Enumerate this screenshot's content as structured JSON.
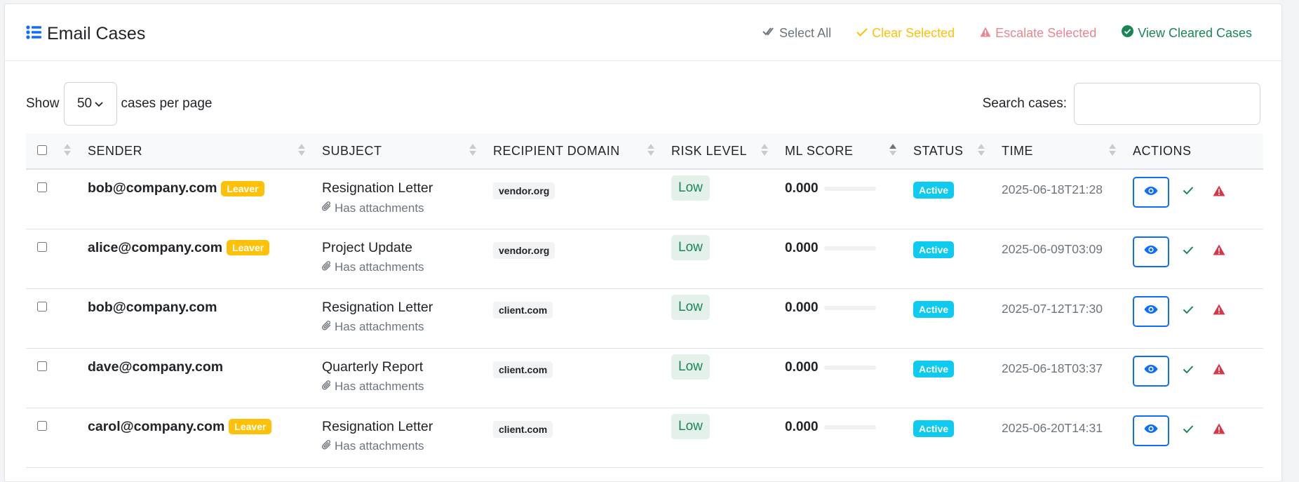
{
  "header": {
    "title": "Email Cases",
    "actions": {
      "select_all": "Select All",
      "clear_selected": "Clear Selected",
      "escalate_selected": "Escalate Selected",
      "view_cleared": "View Cleared Cases"
    }
  },
  "toolbar": {
    "show_label": "Show",
    "per_page_value": "50",
    "per_page_suffix": "cases per page",
    "search_label": "Search cases:",
    "search_value": ""
  },
  "table": {
    "columns": [
      "SENDER",
      "SUBJECT",
      "RECIPIENT DOMAIN",
      "RISK LEVEL",
      "ML SCORE",
      "STATUS",
      "TIME",
      "ACTIONS"
    ],
    "rows": [
      {
        "sender": "bob@company.com",
        "leaver": "Leaver",
        "subject": "Resignation Letter",
        "attachments": "Has attachments",
        "domain": "vendor.org",
        "risk": "Low",
        "ml_score": "0.000",
        "ml_fraction": 0,
        "status": "Active",
        "time": "2025-06-18T21:28"
      },
      {
        "sender": "alice@company.com",
        "leaver": "Leaver",
        "subject": "Project Update",
        "attachments": "Has attachments",
        "domain": "vendor.org",
        "risk": "Low",
        "ml_score": "0.000",
        "ml_fraction": 0,
        "status": "Active",
        "time": "2025-06-09T03:09"
      },
      {
        "sender": "bob@company.com",
        "leaver": "",
        "subject": "Resignation Letter",
        "attachments": "Has attachments",
        "domain": "client.com",
        "risk": "Low",
        "ml_score": "0.000",
        "ml_fraction": 0,
        "status": "Active",
        "time": "2025-07-12T17:30"
      },
      {
        "sender": "dave@company.com",
        "leaver": "",
        "subject": "Quarterly Report",
        "attachments": "Has attachments",
        "domain": "client.com",
        "risk": "Low",
        "ml_score": "0.000",
        "ml_fraction": 0,
        "status": "Active",
        "time": "2025-06-18T03:37"
      },
      {
        "sender": "carol@company.com",
        "leaver": "Leaver",
        "subject": "Resignation Letter",
        "attachments": "Has attachments",
        "domain": "client.com",
        "risk": "Low",
        "ml_score": "0.000",
        "ml_fraction": 0,
        "status": "Active",
        "time": "2025-06-20T14:31"
      }
    ]
  },
  "colors": {
    "primary": "#0d6efd",
    "warning": "#ffc107",
    "danger": "#dc3545",
    "success": "#198754",
    "info": "#0dcaf0",
    "muted": "#6c757d"
  },
  "icons": {
    "title": "list-icon",
    "select_all": "double-check-icon",
    "clear": "check-icon",
    "escalate": "warning-triangle-icon",
    "view_cleared": "check-circle-icon",
    "attachment": "paperclip-icon",
    "view": "eye-icon"
  }
}
